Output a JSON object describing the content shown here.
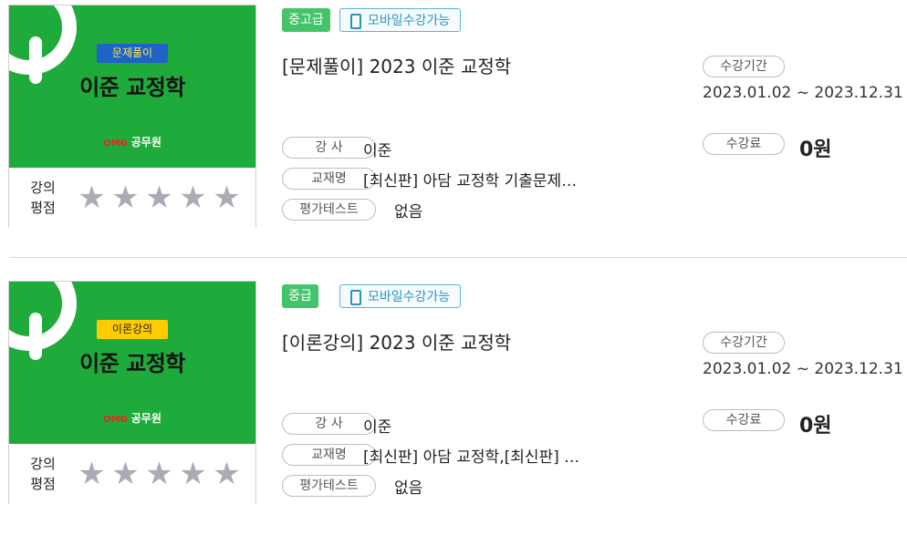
{
  "courses": [
    {
      "category": "문제풀이",
      "thumb_title": "이준 교정학",
      "brand_mark": "OMG",
      "brand_name": "공무원",
      "rating_label_1": "강의",
      "rating_label_2": "평점",
      "rating_value": 0,
      "rating_max": 5,
      "level": "중고급",
      "mobile_label": "모바일수강가능",
      "title": "[문제풀이] 2023 이준 교정학",
      "instructor_label": "강  사",
      "instructor": "이준",
      "textbook_label": "교재명",
      "textbook": "[최신판] 아담 교정학 기출문제…",
      "test_label": "평가테스트",
      "test_value": "없음",
      "period_label": "수강기간",
      "period": "2023.01.02 ~ 2023.12.31",
      "fee_label": "수강료",
      "fee": "0원"
    },
    {
      "category": "이론강의",
      "thumb_title": "이준 교정학",
      "brand_mark": "OMG",
      "brand_name": "공무원",
      "rating_label_1": "강의",
      "rating_label_2": "평점",
      "rating_value": 0,
      "rating_max": 5,
      "level": "중급",
      "mobile_label": "모바일수강가능",
      "title": "[이론강의] 2023 이준 교정학",
      "instructor_label": "강  사",
      "instructor": "이준",
      "textbook_label": "교재명",
      "textbook": "[최신판] 아담 교정학,[최신판] …",
      "test_label": "평가테스트",
      "test_value": "없음",
      "period_label": "수강기간",
      "period": "2023.01.02 ~ 2023.12.31",
      "fee_label": "수강료",
      "fee": "0원"
    }
  ],
  "colors": {
    "thumb_green": "#1fab3b",
    "level_green": "#44c46a",
    "mobile_blue": "#2a94c0",
    "star_gray": "#a9acb3",
    "category_blue": "#1f63c8",
    "category_yellow": "#ffcc00"
  },
  "icons": {
    "star": "star-icon",
    "phone": "mobile-phone-icon",
    "logo": "ring-logo-icon"
  }
}
